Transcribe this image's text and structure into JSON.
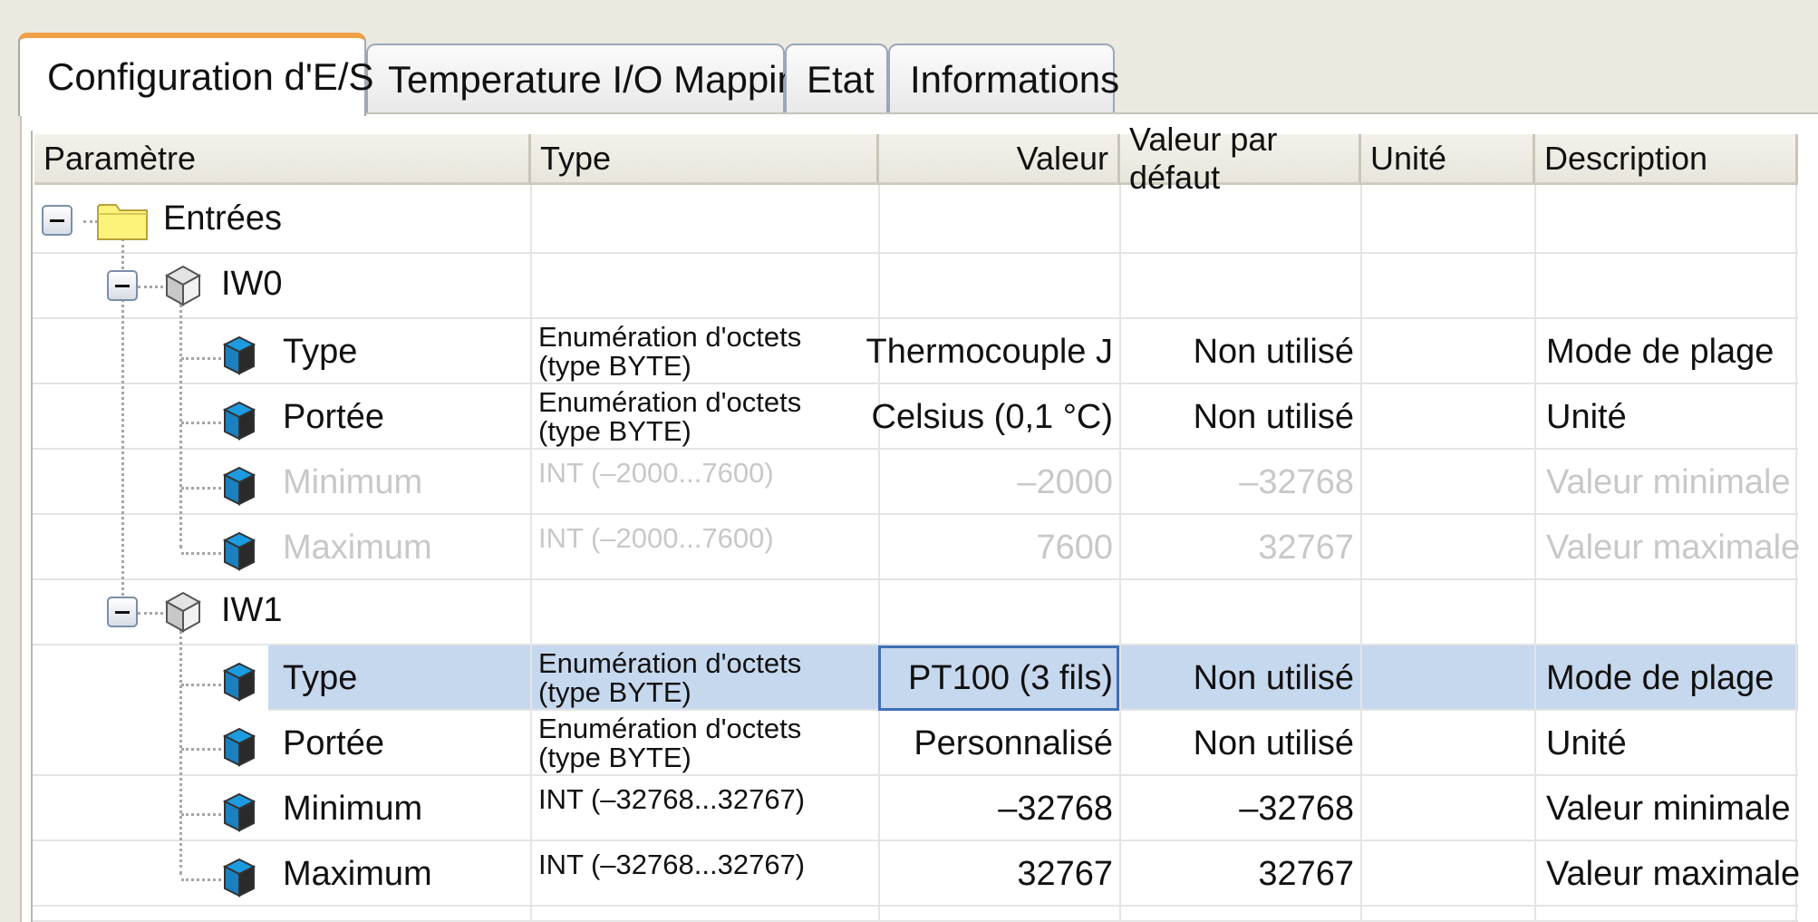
{
  "tabs": [
    {
      "label": "Configuration d'E/S",
      "active": true
    },
    {
      "label": "Temperature I/O Mapping",
      "active": false
    },
    {
      "label": "Etat",
      "active": false
    },
    {
      "label": "Informations",
      "active": false
    }
  ],
  "columns": [
    "Paramètre",
    "Type",
    "Valeur",
    "Valeur par défaut",
    "Unité",
    "Description"
  ],
  "tree": {
    "root": {
      "label": "Entrées",
      "icon": "folder-icon"
    },
    "groups": [
      {
        "label": "IW0",
        "rows": [
          {
            "param": "Type",
            "type": "Enumération d'octets (type BYTE)",
            "value": "Thermocouple J",
            "default": "Non utilisé",
            "unit": "",
            "description": "Mode de plage",
            "disabled": false
          },
          {
            "param": "Portée",
            "type": "Enumération d'octets (type BYTE)",
            "value": "Celsius (0,1 °C)",
            "default": "Non utilisé",
            "unit": "",
            "description": "Unité",
            "disabled": false
          },
          {
            "param": "Minimum",
            "type": "INT (–2000...7600)",
            "value": "–2000",
            "default": "–32768",
            "unit": "",
            "description": "Valeur minimale",
            "disabled": true
          },
          {
            "param": "Maximum",
            "type": "INT (–2000...7600)",
            "value": "7600",
            "default": "32767",
            "unit": "",
            "description": "Valeur maximale",
            "disabled": true
          }
        ]
      },
      {
        "label": "IW1",
        "rows": [
          {
            "param": "Type",
            "type": "Enumération d'octets (type BYTE)",
            "value": "PT100 (3 fils)",
            "default": "Non utilisé",
            "unit": "",
            "description": "Mode de plage",
            "disabled": false,
            "selected": true
          },
          {
            "param": "Portée",
            "type": "Enumération d'octets (type BYTE)",
            "value": "Personnalisé",
            "default": "Non utilisé",
            "unit": "",
            "description": "Unité",
            "disabled": false
          },
          {
            "param": "Minimum",
            "type": "INT (–32768...32767)",
            "value": "–32768",
            "default": "–32768",
            "unit": "",
            "description": "Valeur minimale",
            "disabled": false
          },
          {
            "param": "Maximum",
            "type": "INT (–32768...32767)",
            "value": "32767",
            "default": "32767",
            "unit": "",
            "description": "Valeur maximale",
            "disabled": false
          }
        ]
      }
    ]
  },
  "colors": {
    "selection": "#c6d8ee",
    "selection_border": "#3f6fb7",
    "tab_accent": "#f0a048",
    "disabled_text": "#c8c8c8",
    "folder": "#fdf37a"
  }
}
